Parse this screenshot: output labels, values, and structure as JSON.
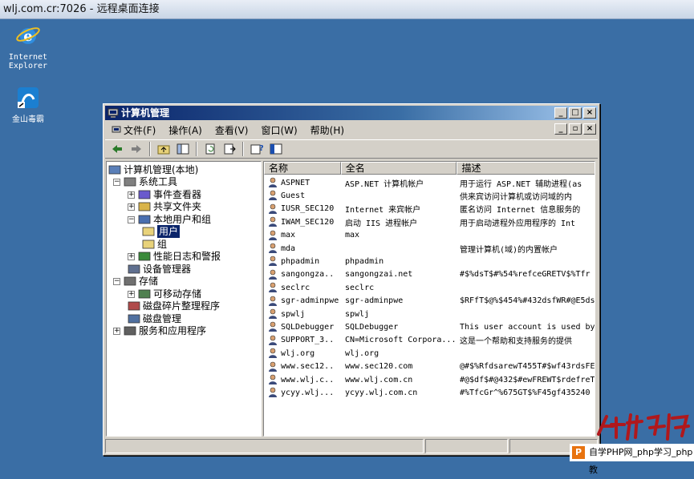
{
  "rdp": {
    "title": "wlj.com.cr:7026 - 远程桌面连接"
  },
  "desktop": {
    "icons": [
      {
        "label": "Internet\nExplorer",
        "icon": "internet-explorer-icon"
      },
      {
        "label": "金山毒霸",
        "icon": "kingsoft-antivirus-icon"
      }
    ]
  },
  "window": {
    "title": "计算机管理",
    "menu": [
      "文件(F)",
      "操作(A)",
      "查看(V)",
      "窗口(W)",
      "帮助(H)"
    ],
    "tree": [
      {
        "label": "计算机管理(本地)",
        "icon": "computer-management-icon",
        "expander": ""
      },
      {
        "label": "系统工具",
        "icon": "tools-icon",
        "expander": "−"
      },
      {
        "label": "事件查看器",
        "icon": "event-viewer-icon",
        "expander": "+"
      },
      {
        "label": "共享文件夹",
        "icon": "shared-folder-icon",
        "expander": "+"
      },
      {
        "label": "本地用户和组",
        "icon": "users-groups-icon",
        "expander": "−"
      },
      {
        "label": "用户",
        "icon": "folder-open-icon",
        "expander": ""
      },
      {
        "label": "组",
        "icon": "folder-icon",
        "expander": ""
      },
      {
        "label": "性能日志和警报",
        "icon": "performance-icon",
        "expander": "+"
      },
      {
        "label": "设备管理器",
        "icon": "device-manager-icon",
        "expander": ""
      },
      {
        "label": "存储",
        "icon": "storage-icon",
        "expander": "−"
      },
      {
        "label": "可移动存储",
        "icon": "removable-storage-icon",
        "expander": "+"
      },
      {
        "label": "磁盘碎片整理程序",
        "icon": "defrag-icon",
        "expander": ""
      },
      {
        "label": "磁盘管理",
        "icon": "disk-management-icon",
        "expander": ""
      },
      {
        "label": "服务和应用程序",
        "icon": "services-icon",
        "expander": "+"
      }
    ],
    "columns": [
      "名称",
      "全名",
      "描述"
    ],
    "users": [
      {
        "name": "ASPNET",
        "fullname": "ASP.NET 计算机帐户",
        "desc": "用于运行 ASP.NET 辅助进程(as"
      },
      {
        "name": "Guest",
        "fullname": "",
        "desc": "供来宾访问计算机或访问域的内"
      },
      {
        "name": "IUSR_SEC120",
        "fullname": "Internet 来宾帐户",
        "desc": "匿名访问 Internet 信息服务的"
      },
      {
        "name": "IWAM_SEC120",
        "fullname": "启动 IIS 进程帐户",
        "desc": "用于启动进程外应用程序的 Int"
      },
      {
        "name": "max",
        "fullname": "max",
        "desc": ""
      },
      {
        "name": "mda",
        "fullname": "",
        "desc": "管理计算机(域)的内置帐户"
      },
      {
        "name": "phpadmin",
        "fullname": "phpadmin",
        "desc": ""
      },
      {
        "name": "sangongza..",
        "fullname": "sangongzai.net",
        "desc": "#$%dsT$#%54%refceGRETV$%Tfr"
      },
      {
        "name": "seclrc",
        "fullname": "seclrc",
        "desc": ""
      },
      {
        "name": "sgr-adminpwe",
        "fullname": "sgr-adminpwe",
        "desc": "$RFfT$@%$454%#432dsfWR#@E5ds"
      },
      {
        "name": "spwlj",
        "fullname": "spwlj",
        "desc": ""
      },
      {
        "name": "SQLDebugger",
        "fullname": "SQLDebugger",
        "desc": "This user account is used by"
      },
      {
        "name": "SUPPORT_3..",
        "fullname": "CN=Microsoft Corpora...",
        "desc": "这是一个帮助和支持服务的提供"
      },
      {
        "name": "wlj.org",
        "fullname": "wlj.org",
        "desc": ""
      },
      {
        "name": "www.sec12..",
        "fullname": "www.sec120.com",
        "desc": "@#$%RfdsarewT455T#$wf43rdsFE"
      },
      {
        "name": "www.wlj.c..",
        "fullname": "www.wlj.com.cn",
        "desc": "#@$df$#@432$#ewFREWT$rdefreT"
      },
      {
        "name": "ycyy.wlj...",
        "fullname": "ycyy.wlj.com.cn",
        "desc": "#%TfcGr^%675GT$%F45gf435240"
      }
    ]
  },
  "watermark": {
    "text": "自学PHP网_php学习_php教",
    "logo": "P"
  },
  "colors": {
    "desktop": "#3a6ea5",
    "titlebar": "#0a246a",
    "selection": "#0a246a"
  }
}
